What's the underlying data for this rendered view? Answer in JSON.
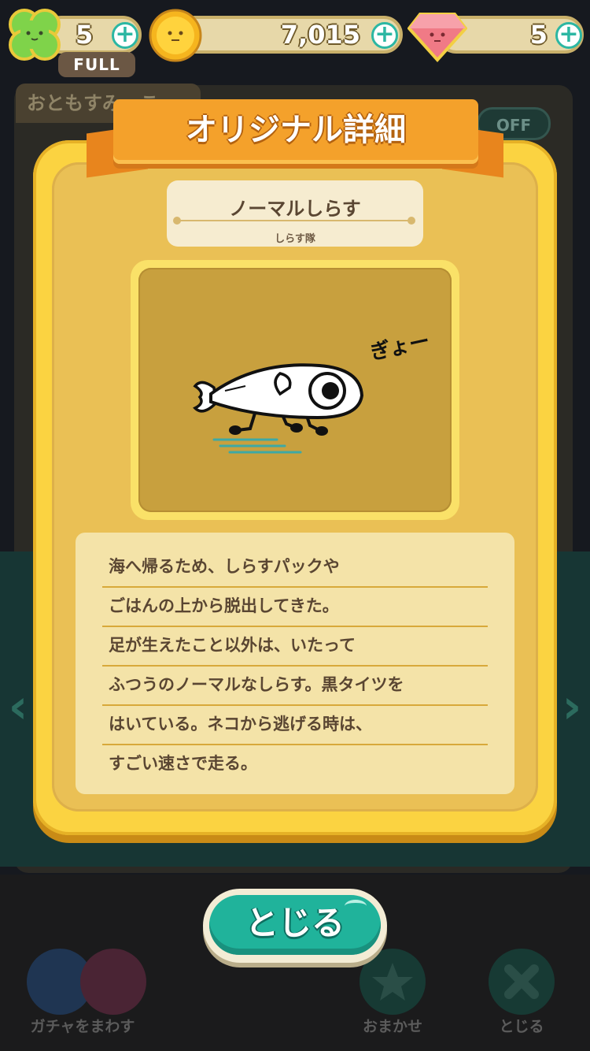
{
  "hud": {
    "clover": {
      "value": "5",
      "badge": "FULL"
    },
    "coins": {
      "value": "7,015"
    },
    "gems": {
      "value": "5"
    }
  },
  "background": {
    "tab_label": "おともすみっこ",
    "toggle_label": "OFF",
    "bottom": {
      "gacha_label": "ガチャをまわす",
      "auto_label": "おまかせ",
      "close_label": "とじる"
    }
  },
  "modal": {
    "title": "オリジナル詳細",
    "character_name": "ノーマルしらす",
    "character_group": "しらす隊",
    "image_caption": "ぎょー",
    "description_lines": [
      "海へ帰るため、しらすパックや",
      "ごはんの上から脱出してきた。",
      "足が生えたこと以外は、いたって",
      "ふつうのノーマルなしらす。黒タイツを",
      "はいている。ネコから逃げる時は、",
      "すごい速さで走る。"
    ],
    "close_button": "とじる"
  },
  "colors": {
    "modal_yellow": "#fbd341",
    "ribbon_orange": "#f4a12b",
    "teal_button": "#20b39b"
  }
}
